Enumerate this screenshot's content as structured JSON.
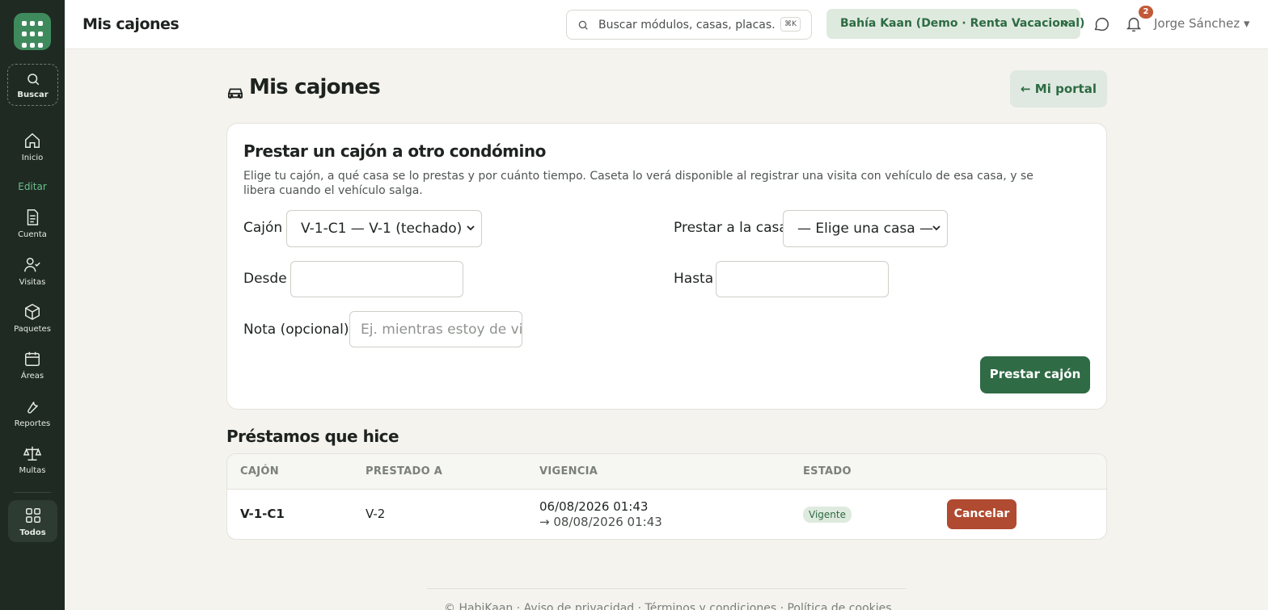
{
  "topbar": {
    "title": "Mis cajones",
    "search_placeholder": "Buscar módulos, casas, placas…",
    "shortcut": "⌘K",
    "org": "Bahía Kaan (Demo · Renta Vacacional)",
    "notif_count": "2",
    "user": "Jorge Sánchez ▾"
  },
  "sidebar": {
    "search": "Buscar",
    "home": "Inicio",
    "edit": "Editar",
    "items": [
      "Cuenta",
      "Visitas",
      "Paquetes",
      "Áreas",
      "Reportes",
      "Multas"
    ],
    "all": "Todos"
  },
  "page": {
    "title": "Mis cajones",
    "portal_btn": "← Mi portal"
  },
  "form": {
    "title": "Prestar un cajón a otro condómino",
    "description": "Elige tu cajón, a qué casa se lo prestas y por cuánto tiempo. Caseta lo verá disponible al registrar una visita con vehículo de esa casa, y se libera cuando el vehículo salga.",
    "cajon_label": "Cajón",
    "cajon_value": "V-1-C1 — V-1 (techado)",
    "casa_label": "Prestar a la casa",
    "casa_value": "— Elige una casa —",
    "desde_label": "Desde",
    "hasta_label": "Hasta",
    "nota_label": "Nota (opcional)",
    "nota_placeholder": "Ej. mientras estoy de vi",
    "submit": "Prestar cajón"
  },
  "loans": {
    "title": "Préstamos que hice",
    "headers": [
      "CAJÓN",
      "PRESTADO A",
      "VIGENCIA",
      "ESTADO"
    ],
    "rows": [
      {
        "cajon": "V-1-C1",
        "prestado_a": "V-2",
        "vigencia_desde": "06/08/2026 01:43",
        "vigencia_hasta": "→ 08/08/2026 01:43",
        "estado": "Vigente",
        "action": "Cancelar"
      }
    ]
  },
  "footer": "© HabiKaan · Aviso de privacidad · Términos y condiciones · Política de cookies"
}
